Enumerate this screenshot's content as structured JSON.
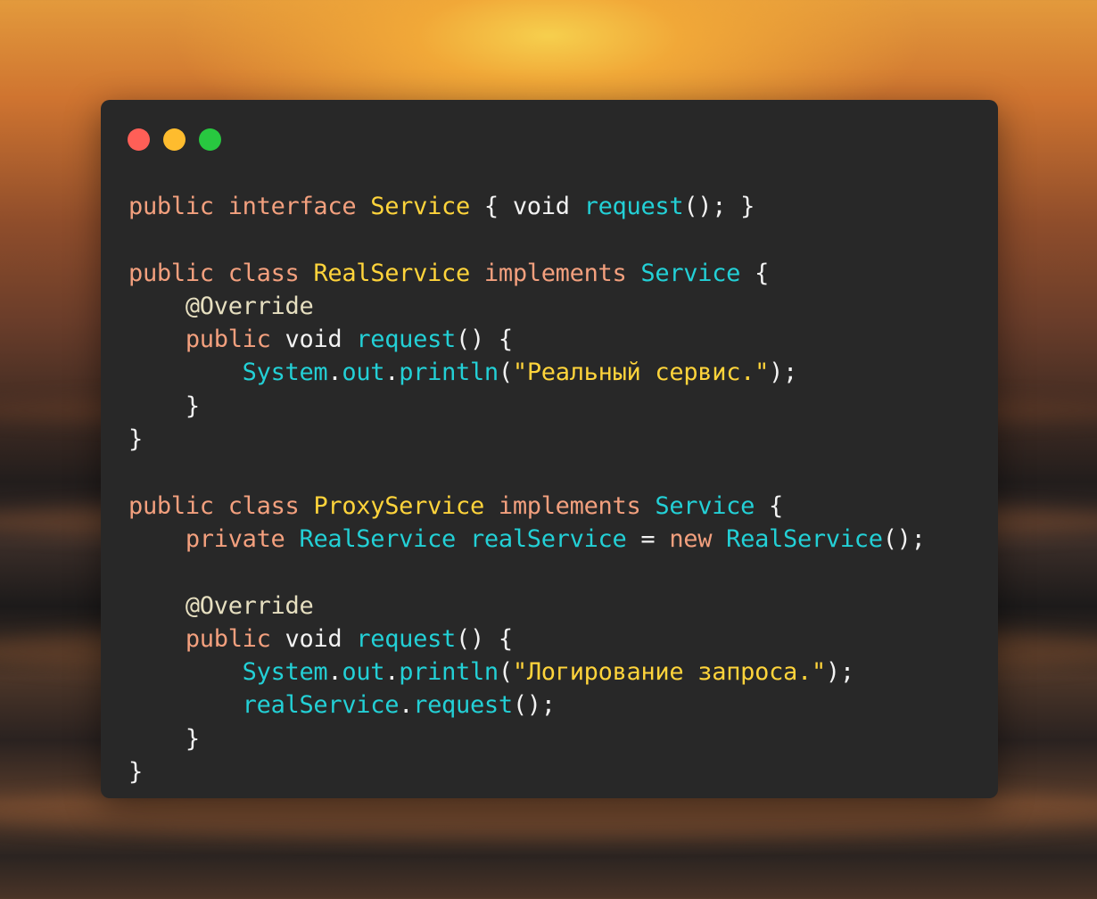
{
  "window": {
    "controls": [
      {
        "name": "close",
        "color": "#ff5f57"
      },
      {
        "name": "minimize",
        "color": "#febc2e"
      },
      {
        "name": "zoom",
        "color": "#28c840"
      }
    ]
  },
  "code": {
    "lines": [
      [
        [
          "kw",
          "public "
        ],
        [
          "kw",
          "interface "
        ],
        [
          "ty",
          "Service"
        ],
        [
          "pl",
          " { void "
        ],
        [
          "fn",
          "request"
        ],
        [
          "pl",
          "(); }"
        ]
      ],
      [],
      [
        [
          "kw",
          "public "
        ],
        [
          "kw",
          "class "
        ],
        [
          "ty",
          "RealService "
        ],
        [
          "kw",
          "implements "
        ],
        [
          "fn",
          "Service"
        ],
        [
          "pl",
          " {"
        ]
      ],
      [
        [
          "pl",
          "    "
        ],
        [
          "an",
          "@Override"
        ]
      ],
      [
        [
          "pl",
          "    "
        ],
        [
          "kw",
          "public "
        ],
        [
          "pl",
          "void "
        ],
        [
          "fn",
          "request"
        ],
        [
          "pl",
          "() {"
        ]
      ],
      [
        [
          "pl",
          "        "
        ],
        [
          "fn",
          "System"
        ],
        [
          "pl",
          "."
        ],
        [
          "fn",
          "out"
        ],
        [
          "pl",
          "."
        ],
        [
          "fn",
          "println"
        ],
        [
          "pl",
          "("
        ],
        [
          "st",
          "\"Реальный сервис.\""
        ],
        [
          "pl",
          ");"
        ]
      ],
      [
        [
          "pl",
          "    }"
        ]
      ],
      [
        [
          "pl",
          "}"
        ]
      ],
      [],
      [
        [
          "kw",
          "public "
        ],
        [
          "kw",
          "class "
        ],
        [
          "ty",
          "ProxyService "
        ],
        [
          "kw",
          "implements "
        ],
        [
          "fn",
          "Service"
        ],
        [
          "pl",
          " {"
        ]
      ],
      [
        [
          "pl",
          "    "
        ],
        [
          "kw",
          "private "
        ],
        [
          "fn",
          "RealService "
        ],
        [
          "fn",
          "realService"
        ],
        [
          "pl",
          " = "
        ],
        [
          "kw",
          "new "
        ],
        [
          "fn",
          "RealService"
        ],
        [
          "pl",
          "();"
        ]
      ],
      [],
      [
        [
          "pl",
          "    "
        ],
        [
          "an",
          "@Override"
        ]
      ],
      [
        [
          "pl",
          "    "
        ],
        [
          "kw",
          "public "
        ],
        [
          "pl",
          "void "
        ],
        [
          "fn",
          "request"
        ],
        [
          "pl",
          "() {"
        ]
      ],
      [
        [
          "pl",
          "        "
        ],
        [
          "fn",
          "System"
        ],
        [
          "pl",
          "."
        ],
        [
          "fn",
          "out"
        ],
        [
          "pl",
          "."
        ],
        [
          "fn",
          "println"
        ],
        [
          "pl",
          "("
        ],
        [
          "st",
          "\"Логирование запроса.\""
        ],
        [
          "pl",
          ");"
        ]
      ],
      [
        [
          "pl",
          "        "
        ],
        [
          "fn",
          "realService"
        ],
        [
          "pl",
          "."
        ],
        [
          "fn",
          "request"
        ],
        [
          "pl",
          "();"
        ]
      ],
      [
        [
          "pl",
          "    }"
        ]
      ],
      [
        [
          "pl",
          "}"
        ]
      ]
    ]
  }
}
